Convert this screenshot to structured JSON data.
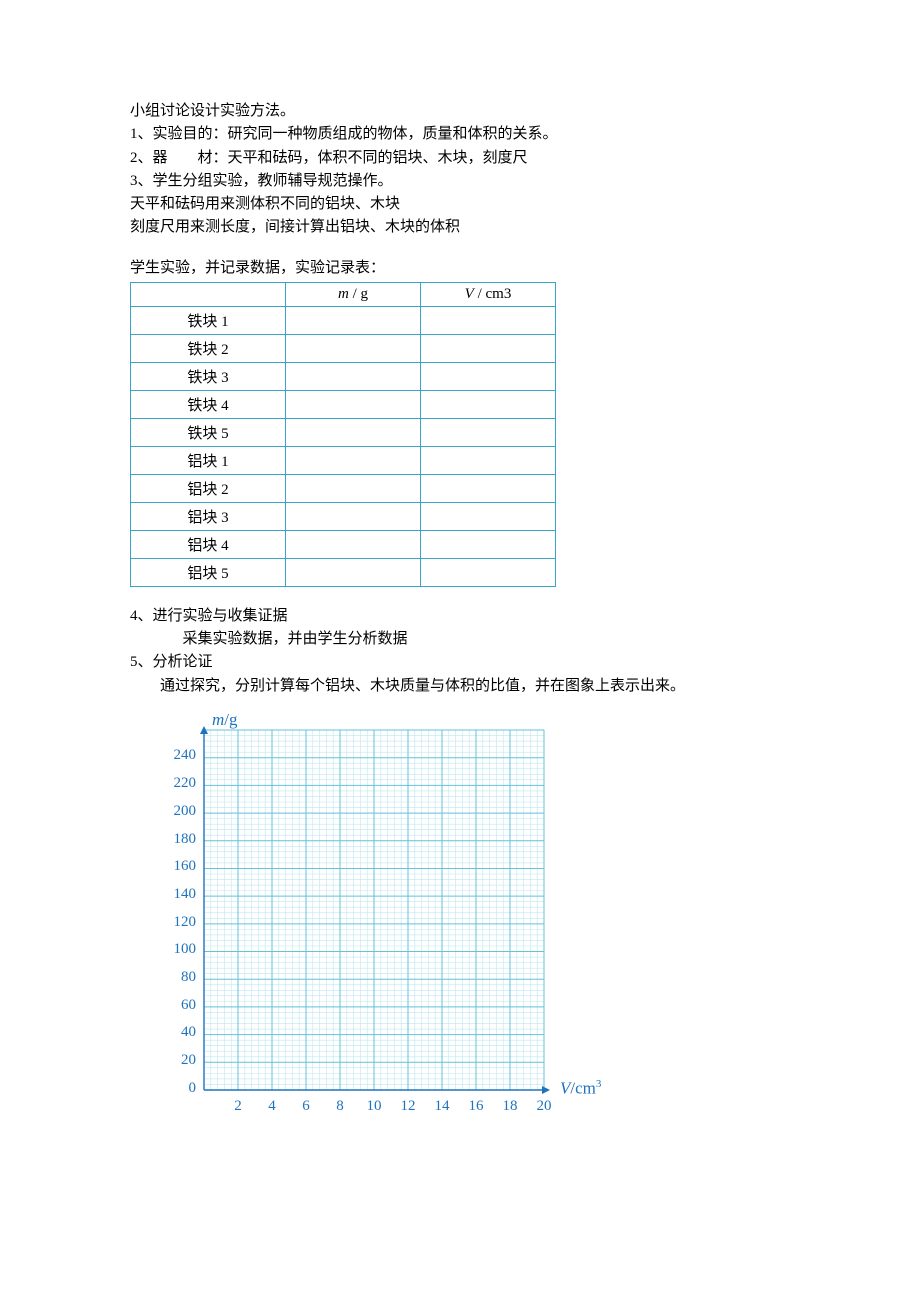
{
  "text": {
    "p0": "小组讨论设计实验方法。",
    "p1": "1、实验目的：研究同一种物质组成的物体，质量和体积的关系。",
    "p2": "2、器　　材：天平和砝码，体积不同的铝块、木块，刻度尺",
    "p3": "3、学生分组实验，教师辅导规范操作。",
    "p4": "天平和砝码用来测体积不同的铝块、木块",
    "p5": "刻度尺用来测长度，间接计算出铝块、木块的体积",
    "p6": "学生实验，并记录数据，实验记录表：",
    "p7": "4、进行实验与收集证据",
    "p8": "采集实验数据，并由学生分析数据",
    "p9": "5、分析论证",
    "p10": "通过探究，分别计算每个铝块、木块质量与体积的比值，并在图象上表示出来。"
  },
  "table": {
    "head_m": "m / g",
    "head_v": "V /  cm3",
    "rows": [
      "铁块 1",
      "铁块 2",
      "铁块 3",
      "铁块 4",
      "铁块 5",
      "铝块 1",
      "铝块 2",
      "铝块 3",
      "铝块 4",
      "铝块 5"
    ]
  },
  "chart_data": {
    "type": "scatter",
    "title": "",
    "xlabel": "V/cm³",
    "ylabel": "m/g",
    "xlim": [
      0,
      20
    ],
    "ylim": [
      0,
      260
    ],
    "x_ticks": [
      2,
      4,
      6,
      8,
      10,
      12,
      14,
      16,
      18,
      20
    ],
    "y_ticks": [
      0,
      20,
      40,
      60,
      80,
      100,
      120,
      140,
      160,
      180,
      200,
      220,
      240
    ],
    "x_minor_per_major": 5,
    "y_minor_per_major": 5,
    "grid": true,
    "series": []
  }
}
